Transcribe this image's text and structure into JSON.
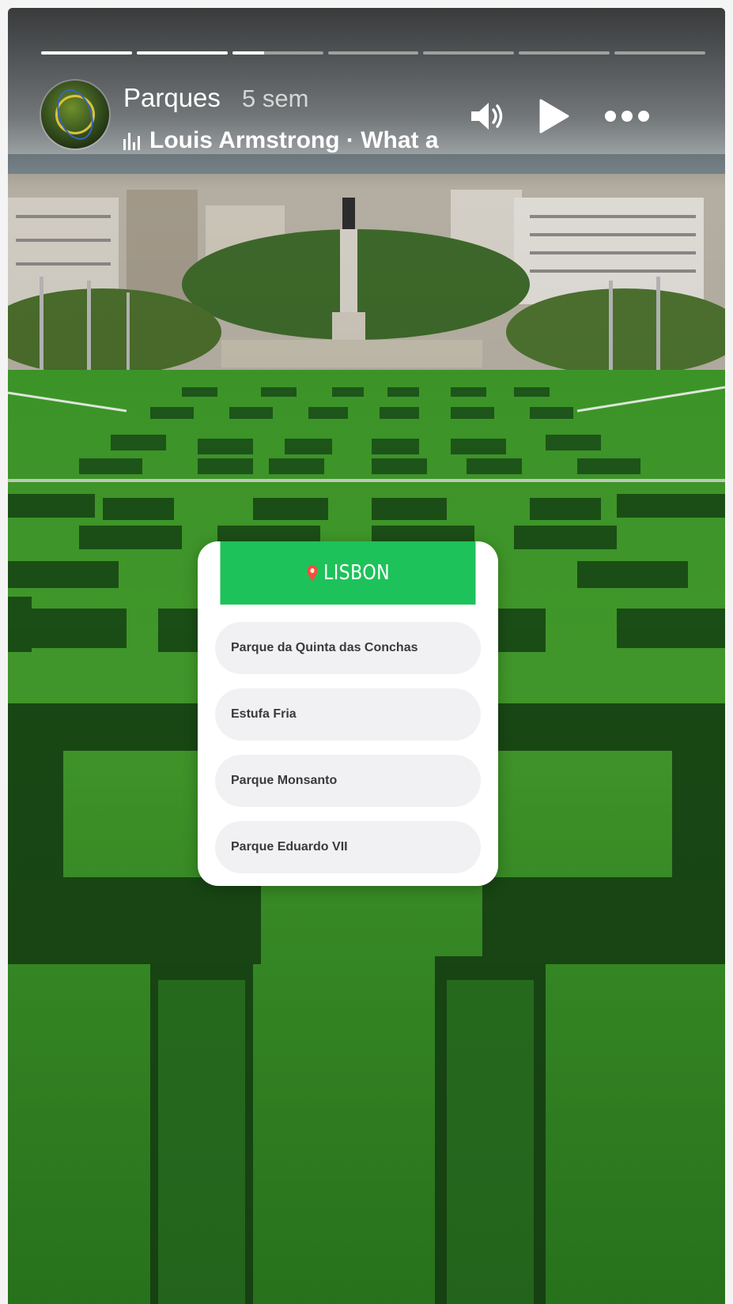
{
  "story": {
    "author": "Parques",
    "time": "5 sem",
    "music": "Louis Armstrong · What a Wonderful World",
    "progress_segments": [
      1,
      1,
      0.35,
      0,
      0,
      0,
      0
    ],
    "controls": {
      "volume_icon": "volume-icon",
      "play_icon": "play-icon",
      "more_icon": "more-icon"
    }
  },
  "poll": {
    "title": "LISBON",
    "accent_color": "#1ec25a",
    "options": [
      "Parque da Quinta das Conchas",
      "Estufa Fria",
      "Parque Monsanto",
      "Parque Eduardo VII"
    ]
  }
}
